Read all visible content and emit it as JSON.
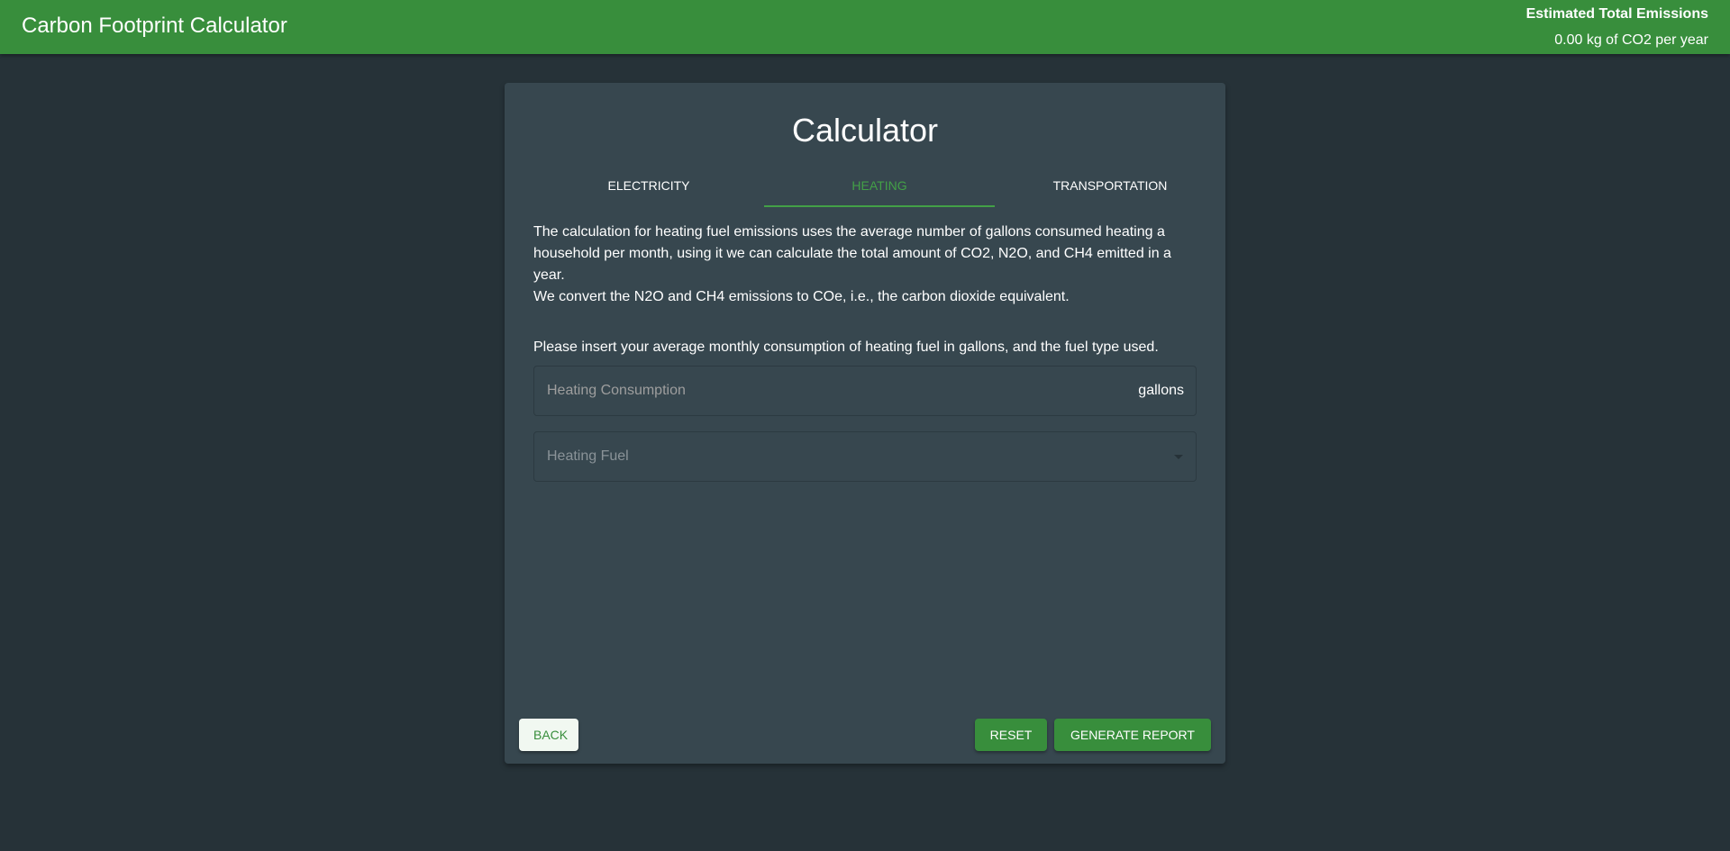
{
  "appbar": {
    "title": "Carbon Footprint Calculator",
    "emissions_title": "Estimated Total Emissions",
    "emissions_value": "0.00 kg of CO2 per year"
  },
  "calculator": {
    "title": "Calculator",
    "tabs": [
      {
        "label": "ELECTRICITY",
        "active": false
      },
      {
        "label": "HEATING",
        "active": true
      },
      {
        "label": "TRANSPORTATION",
        "active": false
      }
    ],
    "description_1": "The calculation for heating fuel emissions uses the average number of gallons consumed heating a household per month, using it we can calculate the total amount of CO2, N2O, and CH4 emitted in a year.",
    "description_2": "We convert the N2O and CH4 emissions to COe, i.e., the carbon dioxide equivalent.",
    "prompt": "Please insert your average monthly consumption of heating fuel in gallons, and the fuel type used.",
    "consumption_field": {
      "placeholder": "Heating Consumption",
      "value": "",
      "unit": "gallons"
    },
    "fuel_select": {
      "placeholder": "Heating Fuel",
      "selected": ""
    },
    "buttons": {
      "back": "BACK",
      "reset": "RESET",
      "generate": "GENERATE REPORT"
    }
  },
  "colors": {
    "primary": "#388e3c",
    "accent": "#43a047",
    "background": "#263238",
    "card": "#37474f"
  },
  "icons": {
    "dropdown": "chevron-down-icon"
  }
}
